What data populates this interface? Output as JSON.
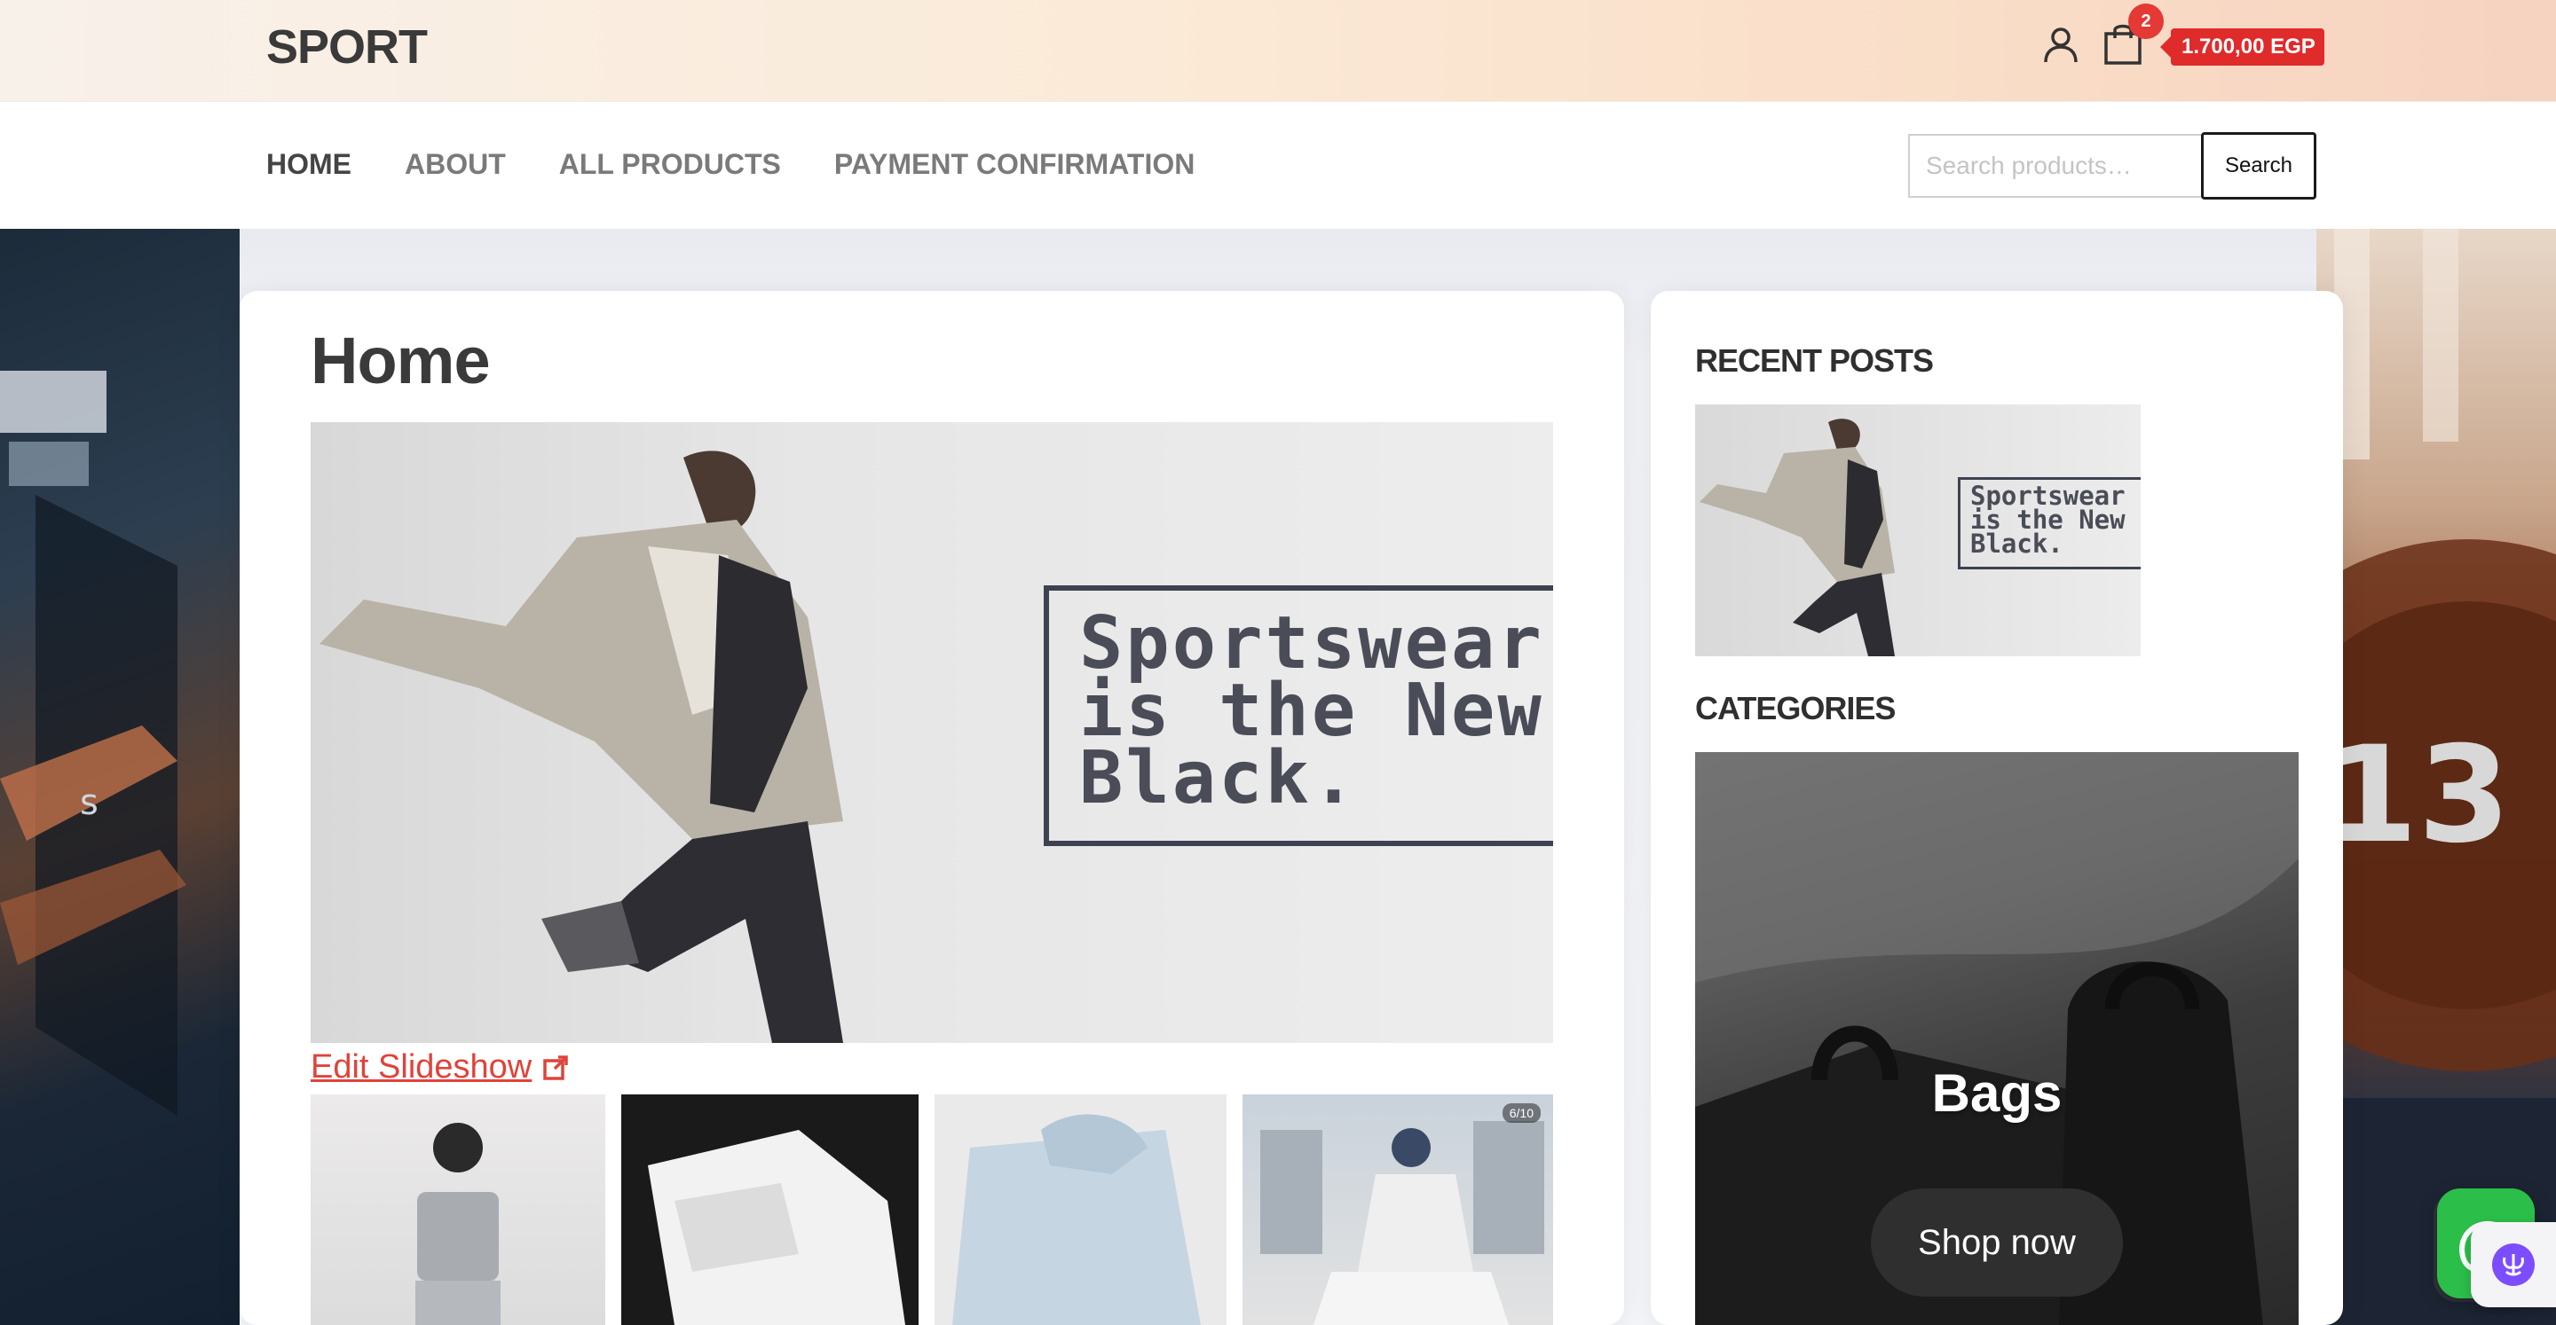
{
  "header": {
    "brand": "SPORT",
    "cart_count": "2",
    "cart_total": "1.700,00 EGP"
  },
  "nav": {
    "items": [
      {
        "label": "HOME",
        "active": true
      },
      {
        "label": "ABOUT",
        "active": false
      },
      {
        "label": "ALL PRODUCTS",
        "active": false
      },
      {
        "label": "PAYMENT CONFIRMATION",
        "active": false
      }
    ],
    "search_placeholder": "Search products…",
    "search_button": "Search"
  },
  "main": {
    "title": "Home",
    "hero_text": [
      "Sportswear",
      "is the New",
      "Black."
    ],
    "edit_slideshow": "Edit Slideshow",
    "thumb_counter": "6/10"
  },
  "sidebar": {
    "recent_posts_heading": "RECENT POSTS",
    "recent_post_text": [
      "Sportswear",
      "is the New",
      "Black."
    ],
    "categories_heading": "CATEGORIES",
    "category_title": "Bags",
    "shop_now": "Shop now"
  },
  "colors": {
    "accent_red": "#e02b2b",
    "link_red": "#e0433a",
    "chat_green": "#2bbf4a"
  },
  "icons": [
    "user-icon",
    "shopping-bag-icon",
    "external-link-icon",
    "chat-icon",
    "brain-icon"
  ]
}
